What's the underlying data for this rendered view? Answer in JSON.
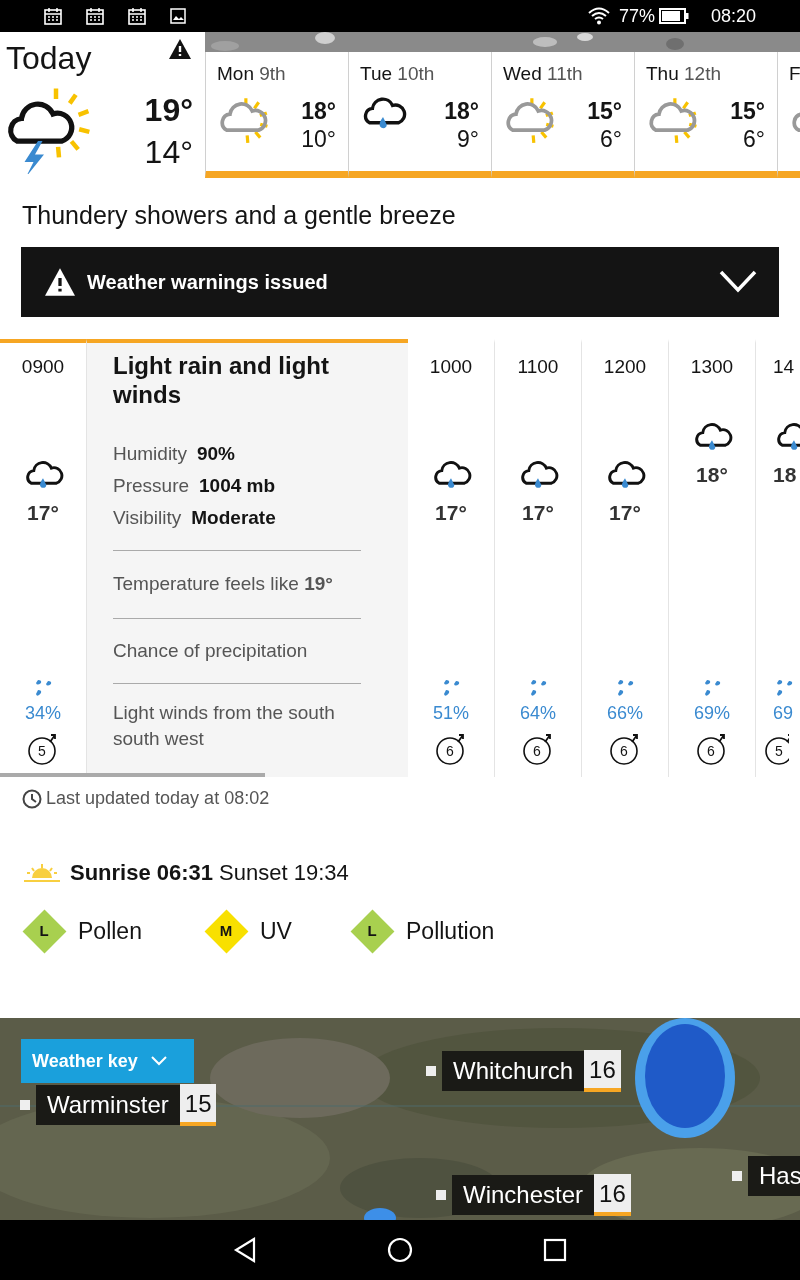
{
  "status_bar": {
    "battery": "77%",
    "time": "08:20"
  },
  "today": {
    "title": "Today",
    "kind": "thunder_sun",
    "high": "19°",
    "low": "14°"
  },
  "days": [
    {
      "day": "Mon",
      "date": "9th",
      "kind": "sun_cloud",
      "high": "18°",
      "low": "10°"
    },
    {
      "day": "Tue",
      "date": "10th",
      "kind": "rain_cloud",
      "high": "18°",
      "low": "9°"
    },
    {
      "day": "Wed",
      "date": "11th",
      "kind": "sun_cloud",
      "high": "15°",
      "low": "6°"
    },
    {
      "day": "Thu",
      "date": "12th",
      "kind": "sun_cloud",
      "high": "15°",
      "low": "6°"
    },
    {
      "day": "F",
      "kind": "sun_cloud"
    }
  ],
  "summary": "Thundery showers and a gentle breeze",
  "warning": {
    "label": "Weather warnings issued",
    "expanded": false
  },
  "hours": [
    {
      "time": "0900",
      "temp": "17°",
      "precip": "34%",
      "wind": "5",
      "selected": true
    },
    {
      "time": "1000",
      "temp": "17°",
      "precip": "51%",
      "wind": "6",
      "selected": false
    },
    {
      "time": "1100",
      "temp": "17°",
      "precip": "64%",
      "wind": "6",
      "selected": false
    },
    {
      "time": "1200",
      "temp": "17°",
      "precip": "66%",
      "wind": "6",
      "selected": false
    },
    {
      "time": "1300",
      "temp": "18°",
      "precip": "69%",
      "wind": "6",
      "selected": false
    },
    {
      "time": "14",
      "temp": "18",
      "precip": "69",
      "wind": "5",
      "selected": false
    }
  ],
  "detail": {
    "title": "Light rain and light winds",
    "stats": [
      {
        "label": "Humidity",
        "value": "90%"
      },
      {
        "label": "Pressure",
        "value": "1004 mb"
      },
      {
        "label": "Visibility",
        "value": "Moderate"
      }
    ],
    "feels": "Temperature feels like **19°**",
    "precip": "Chance of precipitation",
    "wind": "Light winds from the south south west"
  },
  "updated": "Last updated today at 08:02",
  "sun": {
    "sunrise": "Sunrise 06:31",
    "sunset": "Sunset 19:34"
  },
  "indices": [
    {
      "letter": "L",
      "label": "Pollen",
      "color": "#a8d04f"
    },
    {
      "letter": "M",
      "label": "UV",
      "color": "#f8e000"
    },
    {
      "letter": "L",
      "label": "Pollution",
      "color": "#a8d04f"
    }
  ],
  "map": {
    "key_button": "Weather key",
    "places": [
      {
        "name": "Warminster",
        "temp": "15"
      },
      {
        "name": "Whitchurch",
        "temp": "16"
      },
      {
        "name": "Winchester",
        "temp": "16"
      },
      {
        "name": "Has"
      }
    ]
  }
}
